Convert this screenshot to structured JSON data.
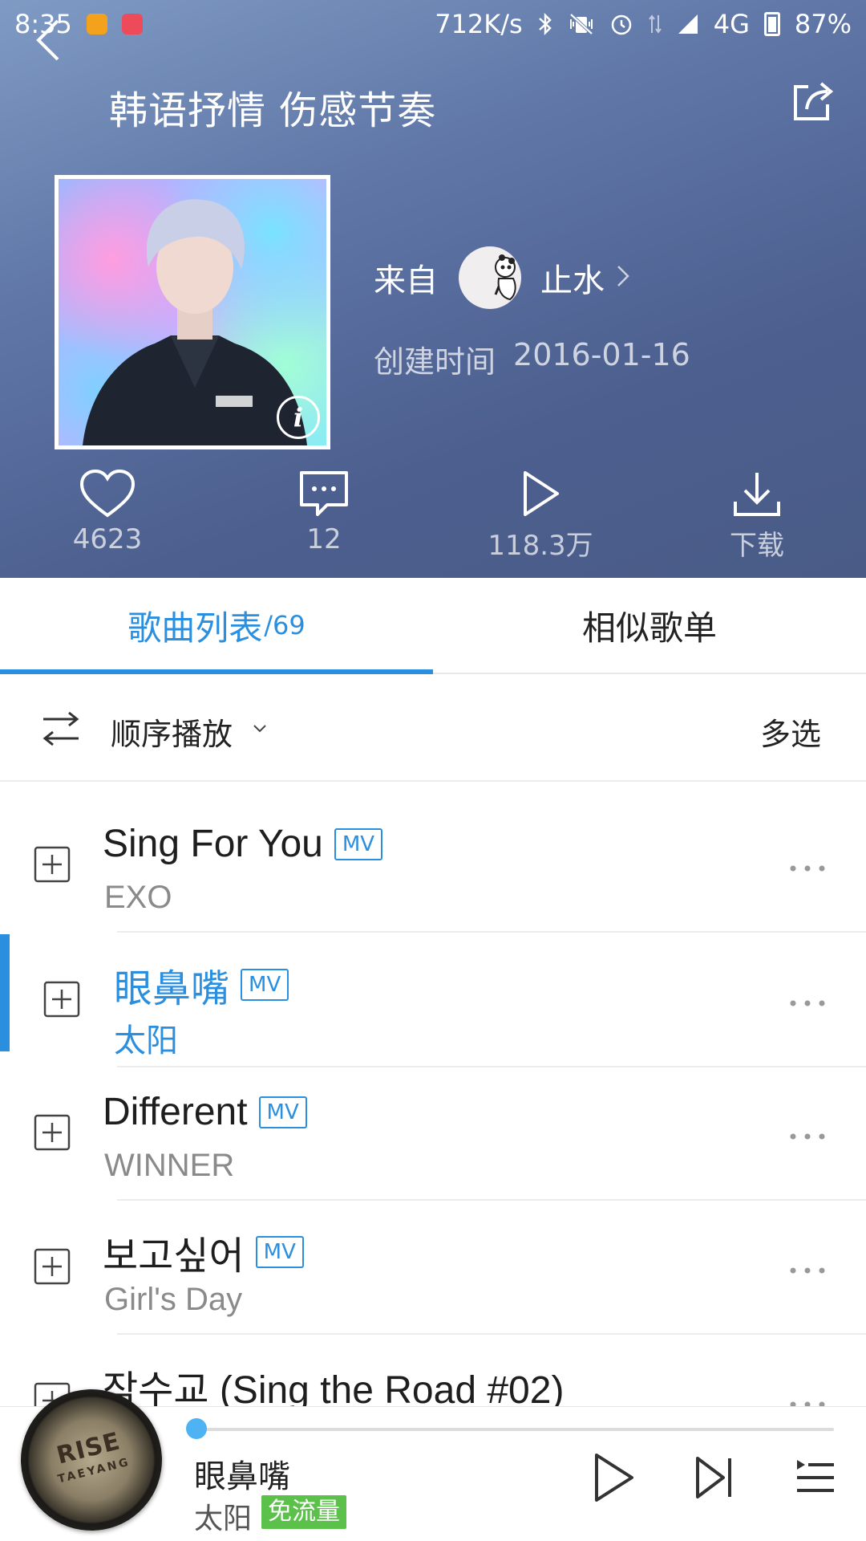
{
  "status_bar": {
    "time": "8:35",
    "net_speed": "712K/s",
    "network": "4G",
    "battery": "87%",
    "icons": [
      "app-k-icon",
      "app-red-icon",
      "bluetooth-icon",
      "mute-vibrate-icon",
      "alarm-icon",
      "data-arrows-icon",
      "signal-icon",
      "battery-icon"
    ]
  },
  "header": {
    "title": "韩语抒情 伤感节奏",
    "from_label": "来自",
    "creator": "止水",
    "created_label": "创建时间",
    "created_date": "2016-01-16"
  },
  "actions": {
    "like_count": "4623",
    "comment_count": "12",
    "play_count": "118.3万",
    "download_label": "下载"
  },
  "tabs": {
    "songs_label": "歌曲列表",
    "songs_count": "/69",
    "similar_label": "相似歌单"
  },
  "playmode": {
    "label": "顺序播放",
    "multi_select": "多选"
  },
  "songs": [
    {
      "title": "Sing For You",
      "artist": "EXO",
      "mv": "MV"
    },
    {
      "title": "眼鼻嘴",
      "artist": "太阳",
      "mv": "MV"
    },
    {
      "title": "Different",
      "artist": "WINNER",
      "mv": "MV"
    },
    {
      "title": "보고싶어",
      "artist": "Girl's Day",
      "mv": "MV"
    },
    {
      "title": "잠수교 (Sing the Road #02)",
      "artist": ""
    }
  ],
  "player": {
    "title": "眼鼻嘴",
    "artist": "太阳",
    "badge": "免流量",
    "disc_text": "RISE",
    "disc_subtext": "TAEYANG",
    "progress": 0.0
  },
  "colors": {
    "accent": "#2b8fe0",
    "badge_green": "#5cc14b"
  }
}
